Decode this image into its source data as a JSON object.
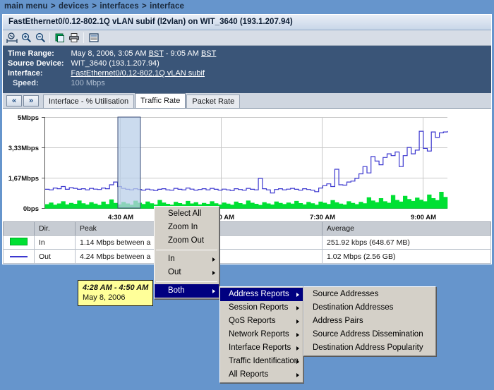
{
  "breadcrumb": {
    "items": [
      "main menu",
      "devices",
      "interfaces",
      "interface"
    ],
    "separator": ">"
  },
  "panel": {
    "title": "FastEthernet0/0.12-802.1Q vLAN subif (l2vlan) on WIT_3640 (193.1.207.94)"
  },
  "toolbar": {
    "icons": [
      {
        "name": "pan-select-icon",
        "title": "Select"
      },
      {
        "name": "zoom-in-icon",
        "title": "Zoom In"
      },
      {
        "name": "zoom-out-icon",
        "title": "Zoom Out"
      },
      {
        "name": "export-icon",
        "title": "Export"
      },
      {
        "name": "print-icon",
        "title": "Print"
      },
      {
        "name": "report-icon",
        "title": "Report"
      }
    ]
  },
  "info": {
    "time_range_label": "Time Range:",
    "time_range_value_a": "May 8, 2006, 3:05 AM ",
    "time_range_tz_a": "BST",
    "time_range_value_b": " - 9:05 AM ",
    "time_range_tz_b": "BST",
    "source_device_label": "Source Device:",
    "source_device_value": "WIT_3640 (193.1.207.94)",
    "interface_label": "Interface:",
    "interface_value": "FastEthernet0/0.12-802.1Q vLAN subif",
    "speed_label": "Speed:",
    "speed_value": "100 Mbps"
  },
  "tabs": {
    "prev_label": "«",
    "next_label": "»",
    "items": [
      {
        "label": "Interface - % Utilisation",
        "active": false
      },
      {
        "label": "Traffic Rate",
        "active": true
      },
      {
        "label": "Packet Rate",
        "active": false
      }
    ]
  },
  "tooltip": {
    "time_range": "4:28 AM - 4:50 AM",
    "date": "May 8, 2006"
  },
  "chart_data": {
    "type": "area",
    "title": "Traffic Rate",
    "xlabel": "",
    "ylabel": "",
    "grid": true,
    "legend_position": "table-below",
    "ytick_labels": [
      "5Mbps",
      "3,33Mbps",
      "1,67Mbps",
      "0bps"
    ],
    "ytick_values": [
      5000000,
      3330000,
      1670000,
      0
    ],
    "ylim": [
      0,
      5000000
    ],
    "xtick_labels": [
      "4:30 AM",
      "6:00 AM",
      "7:30 AM",
      "9:00 AM"
    ],
    "xlim": [
      "3:05 AM",
      "9:05 AM"
    ],
    "selection": {
      "from": "4:28 AM",
      "to": "4:50 AM",
      "color": "#b9cfe8"
    },
    "series": [
      {
        "name": "In",
        "color": "#00e033",
        "style": "area",
        "values": [
          0.22,
          0.31,
          0.19,
          0.26,
          0.38,
          0.21,
          0.29,
          0.24,
          0.42,
          0.27,
          0.2,
          0.33,
          0.25,
          0.18,
          0.36,
          0.23,
          0.48,
          0.29,
          0.21,
          0.34,
          0.26,
          0.19,
          0.41,
          0.3,
          0.23,
          0.37,
          0.27,
          0.2,
          0.45,
          0.31,
          0.24,
          0.19,
          0.35,
          0.28,
          0.22,
          0.4,
          0.26,
          0.33,
          0.21,
          0.29,
          0.24,
          0.38,
          0.27,
          0.2,
          0.31,
          0.25,
          0.19,
          0.36,
          0.28,
          0.22,
          0.42,
          0.3,
          0.24,
          0.18,
          0.33,
          0.26,
          0.2,
          0.37,
          0.29,
          0.23,
          0.31,
          0.25,
          0.4,
          0.28,
          0.21,
          0.34,
          0.27,
          0.19,
          0.36,
          0.3,
          0.23,
          0.44,
          0.32,
          0.25,
          0.2,
          0.38,
          0.29,
          0.22,
          0.35,
          0.27,
          0.6,
          0.42,
          0.33,
          0.55,
          0.38,
          0.3,
          0.72,
          0.45,
          0.36,
          0.68,
          0.5,
          0.4,
          0.58,
          0.46,
          0.38,
          0.75,
          0.55,
          0.44,
          0.9,
          0.62,
          0.5
        ]
      },
      {
        "name": "Out",
        "color": "#3b37cf",
        "style": "line",
        "values": [
          1.05,
          1.02,
          1.12,
          1.08,
          1.2,
          1.05,
          1.14,
          1.1,
          1.05,
          1.08,
          1.02,
          1.1,
          1.06,
          1.04,
          1.12,
          1.08,
          1.3,
          1.45,
          1.2,
          1.1,
          1.05,
          1.02,
          1.08,
          1.04,
          1.0,
          1.06,
          1.02,
          0.98,
          1.05,
          1.08,
          1.02,
          1.0,
          1.1,
          1.05,
          1.02,
          1.12,
          1.06,
          1.0,
          1.04,
          1.08,
          1.02,
          1.1,
          1.05,
          1.0,
          1.06,
          1.02,
          0.98,
          1.08,
          1.04,
          1.0,
          1.1,
          1.05,
          1.02,
          1.65,
          1.08,
          1.02,
          0.85,
          1.04,
          1.08,
          1.02,
          1.06,
          1.1,
          1.05,
          1.0,
          1.08,
          1.04,
          1.0,
          0.92,
          1.12,
          1.25,
          1.35,
          1.2,
          2.15,
          1.3,
          1.28,
          1.45,
          1.5,
          1.65,
          1.9,
          2.3,
          1.95,
          2.85,
          2.6,
          2.4,
          2.8,
          3.0,
          2.9,
          3.1,
          2.3,
          2.9,
          3.35,
          3.0,
          3.2,
          4.24,
          3.3,
          3.15,
          4.2,
          3.9,
          4.15,
          4.2,
          4.25
        ]
      }
    ]
  },
  "table": {
    "headers": [
      "",
      "Dir.",
      "Peak",
      "Average"
    ],
    "rows": [
      {
        "swatch": "in-swatch",
        "dir": "In",
        "peak": "1.14 Mbps between a",
        "average": "251.92 kbps (648.67 MB)"
      },
      {
        "swatch": "out-swatch",
        "dir": "Out",
        "peak": "4.24 Mbps between a",
        "average": "1.02 Mbps (2.56 GB)"
      }
    ]
  },
  "context_menu": {
    "level1": [
      {
        "label": "Select All",
        "submenu": false,
        "highlighted": false
      },
      {
        "label": "Zoom In",
        "submenu": false,
        "highlighted": false
      },
      {
        "label": "Zoom Out",
        "submenu": false,
        "highlighted": false
      },
      {
        "label": "In",
        "submenu": true,
        "highlighted": false
      },
      {
        "label": "Out",
        "submenu": true,
        "highlighted": false
      },
      {
        "label": "Both",
        "submenu": true,
        "highlighted": true
      }
    ],
    "level2": [
      {
        "label": "Address Reports",
        "submenu": true,
        "highlighted": true
      },
      {
        "label": "Session Reports",
        "submenu": true,
        "highlighted": false
      },
      {
        "label": "QoS Reports",
        "submenu": true,
        "highlighted": false
      },
      {
        "label": "Network Reports",
        "submenu": true,
        "highlighted": false
      },
      {
        "label": "Interface Reports",
        "submenu": true,
        "highlighted": false
      },
      {
        "label": "Traffic Identification",
        "submenu": true,
        "highlighted": false
      },
      {
        "label": "All Reports",
        "submenu": true,
        "highlighted": false
      }
    ],
    "level3": [
      {
        "label": "Source Addresses"
      },
      {
        "label": "Destination Addresses"
      },
      {
        "label": "Address Pairs"
      },
      {
        "label": "Source Address Dissemination"
      },
      {
        "label": "Destination Address Popularity"
      }
    ]
  },
  "colors": {
    "page_bg": "#6695cc",
    "info_bg": "#3a5578",
    "menu_bg": "#d4d0c8",
    "menu_highlight": "#000080",
    "in_series": "#00e033",
    "out_series": "#3b37cf",
    "tooltip_bg": "#ffff99",
    "selection_band": "#b9cfe8"
  }
}
